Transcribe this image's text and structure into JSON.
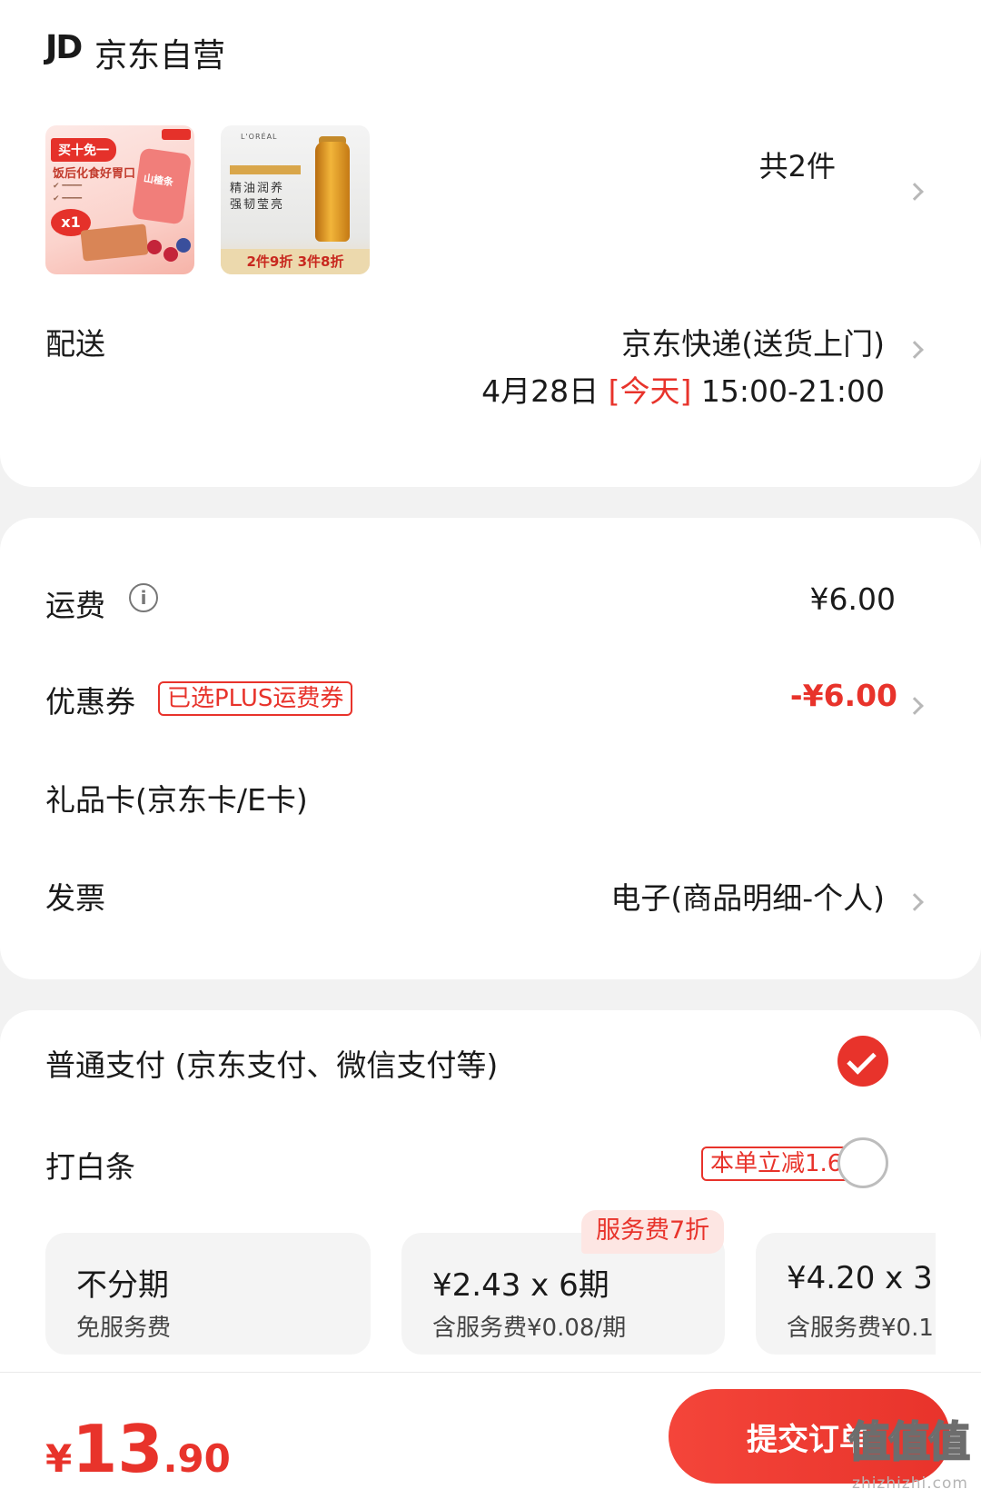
{
  "store": {
    "logo": "JD",
    "name": "京东自营"
  },
  "products": {
    "count_label": "共2件",
    "item1": {
      "badge": "买十免一",
      "headline": "饭后化食好胃口",
      "pack_label": "山楂条",
      "qty": "x1"
    },
    "item2": {
      "brand": "L'ORÉAL",
      "line1": "精油润养",
      "line2": "强韧莹亮",
      "promo": "2件9折 3件8折"
    }
  },
  "delivery": {
    "label": "配送",
    "method": "京东快递(送货上门)",
    "date": "4月28日",
    "today": "[今天]",
    "time": "15:00-21:00"
  },
  "fees": {
    "shipping_label": "运费",
    "shipping_value": "¥6.00",
    "coupon_label": "优惠券",
    "coupon_tag": "已选PLUS运费券",
    "coupon_value": "-¥6.00",
    "giftcard_label": "礼品卡(京东卡/E卡)",
    "invoice_label": "发票",
    "invoice_value": "电子(商品明细-个人)"
  },
  "payment": {
    "normal_label": "普通支付 (京东支付、微信支付等)",
    "baitiao_label": "打白条",
    "baitiao_tag": "本单立减1.6元",
    "plans": [
      {
        "title": "不分期",
        "sub": "免服务费"
      },
      {
        "title": "¥2.43 x 6期",
        "sub": "含服务费¥0.08/期",
        "tag": "服务费7折"
      },
      {
        "title": "¥4.20 x 3",
        "sub": "含服务费¥0.1"
      }
    ]
  },
  "footer": {
    "currency": "¥",
    "total_int": "13",
    "total_dec": ".90",
    "submit_label": "提交订单",
    "watermark": "值值值",
    "watermark_sub": "zhizhizhi.com"
  },
  "colors": {
    "accent": "#e8332b",
    "background": "#f2f2f2",
    "card": "#ffffff"
  },
  "icons": [
    "info-icon",
    "chevron-right-icon",
    "check-icon"
  ]
}
